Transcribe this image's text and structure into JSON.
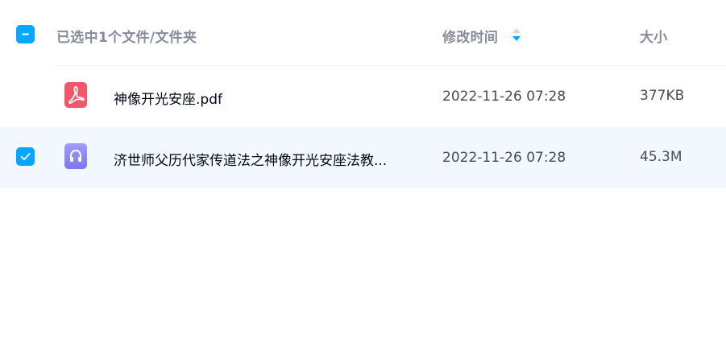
{
  "header": {
    "selection_label": "已选中1个文件/文件夹",
    "modified_label": "修改时间",
    "size_label": "大小",
    "sort_icon": "sort-descending-icon"
  },
  "colors": {
    "accent": "#06a7ff",
    "selected_row_bg": "#f2f8fe",
    "pdf_red": "#f2566b",
    "audio_purple": "#8a84f5"
  },
  "files": [
    {
      "name": "神像开光安座.pdf",
      "modified": "2022-11-26 07:28",
      "size": "377KB",
      "icon": "pdf-file-icon",
      "selected": false
    },
    {
      "name": "济世师父历代家传道法之神像开光安座法教...",
      "modified": "2022-11-26 07:28",
      "size": "45.3M",
      "icon": "audio-file-icon",
      "selected": true
    }
  ]
}
